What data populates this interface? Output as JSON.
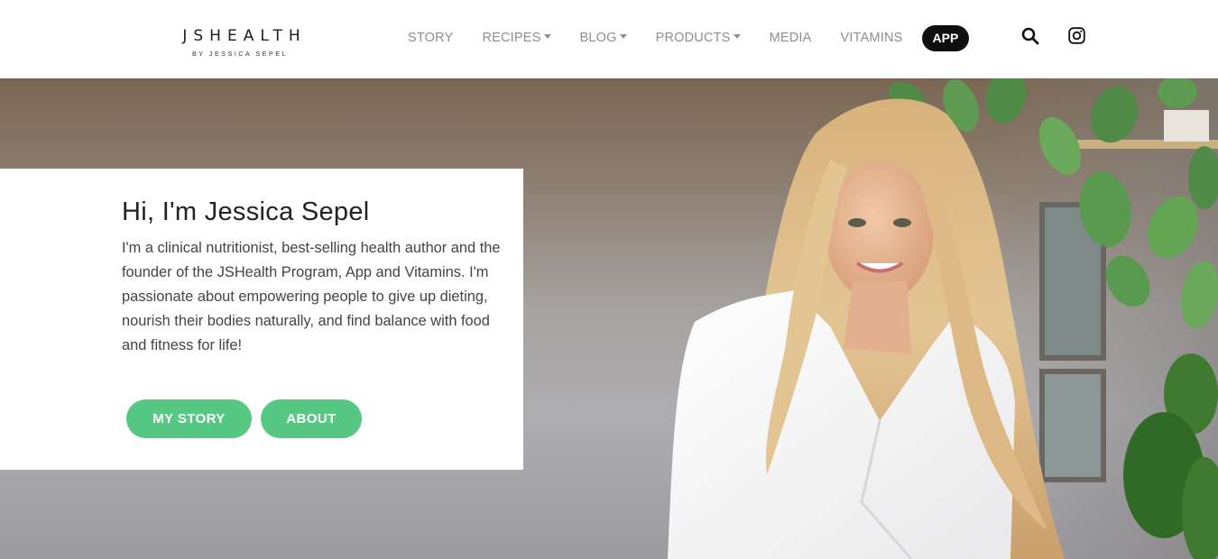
{
  "header": {
    "logo_main": "JSHEALTH",
    "logo_sub": "BY JESSICA SEPEL",
    "nav": [
      {
        "label": "STORY",
        "has_dropdown": false
      },
      {
        "label": "RECIPES",
        "has_dropdown": true
      },
      {
        "label": "BLOG",
        "has_dropdown": true
      },
      {
        "label": "PRODUCTS",
        "has_dropdown": true
      },
      {
        "label": "MEDIA",
        "has_dropdown": false
      },
      {
        "label": "VITAMINS",
        "has_dropdown": false
      }
    ],
    "app_label": "APP",
    "icons": [
      "search-icon",
      "instagram-icon"
    ]
  },
  "hero": {
    "title": "Hi, I'm Jessica Sepel",
    "text": "I'm a clinical nutritionist, best-selling health author and the founder of the JSHealth Program, App and Vitamins. I'm passionate about empowering people to give up dieting, nourish their bodies naturally, and find balance with food and fitness for life!",
    "buttons": {
      "story": "MY STORY",
      "about": "ABOUT"
    }
  },
  "colors": {
    "accent_green": "#57c784",
    "app_pill": "#0f0f0f",
    "nav_text": "#8e8e8e"
  }
}
